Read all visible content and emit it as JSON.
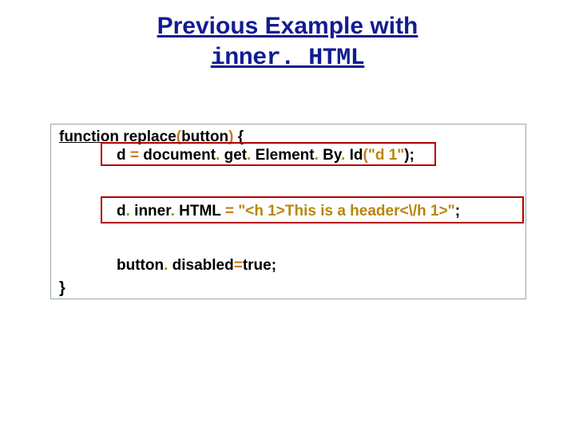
{
  "title": {
    "line1": "Previous Example with",
    "line2": "inner. HTML"
  },
  "code": {
    "fn_keyword": "function ",
    "fn_name": "replace",
    "paren_open": "(",
    "param": "button",
    "paren_close": ")",
    "space_brace": " {",
    "assign": {
      "lhs": "d ",
      "eq": "= ",
      "obj1": "document",
      "dot1": ". ",
      "m1": "get",
      "dot2": ". ",
      "m2": "Element",
      "dot3": ". ",
      "m3": "By",
      "dot4": ". ",
      "m4": "Id",
      "po": "(",
      "str": "\"d 1\"",
      "pc": ");"
    },
    "inner": {
      "lhs": "d",
      "dot1": ". ",
      "p1": "inner",
      "dot2": ". ",
      "p2": "HTML ",
      "eq": "= ",
      "str": "\"<h 1>This is a header<\\/h 1>\"",
      "semi": ";"
    },
    "disabled": {
      "obj": "button",
      "dot1": ". ",
      "prop": "disabled",
      "eq": "=",
      "val": "true",
      "semi": ";"
    },
    "close_brace": "}"
  }
}
